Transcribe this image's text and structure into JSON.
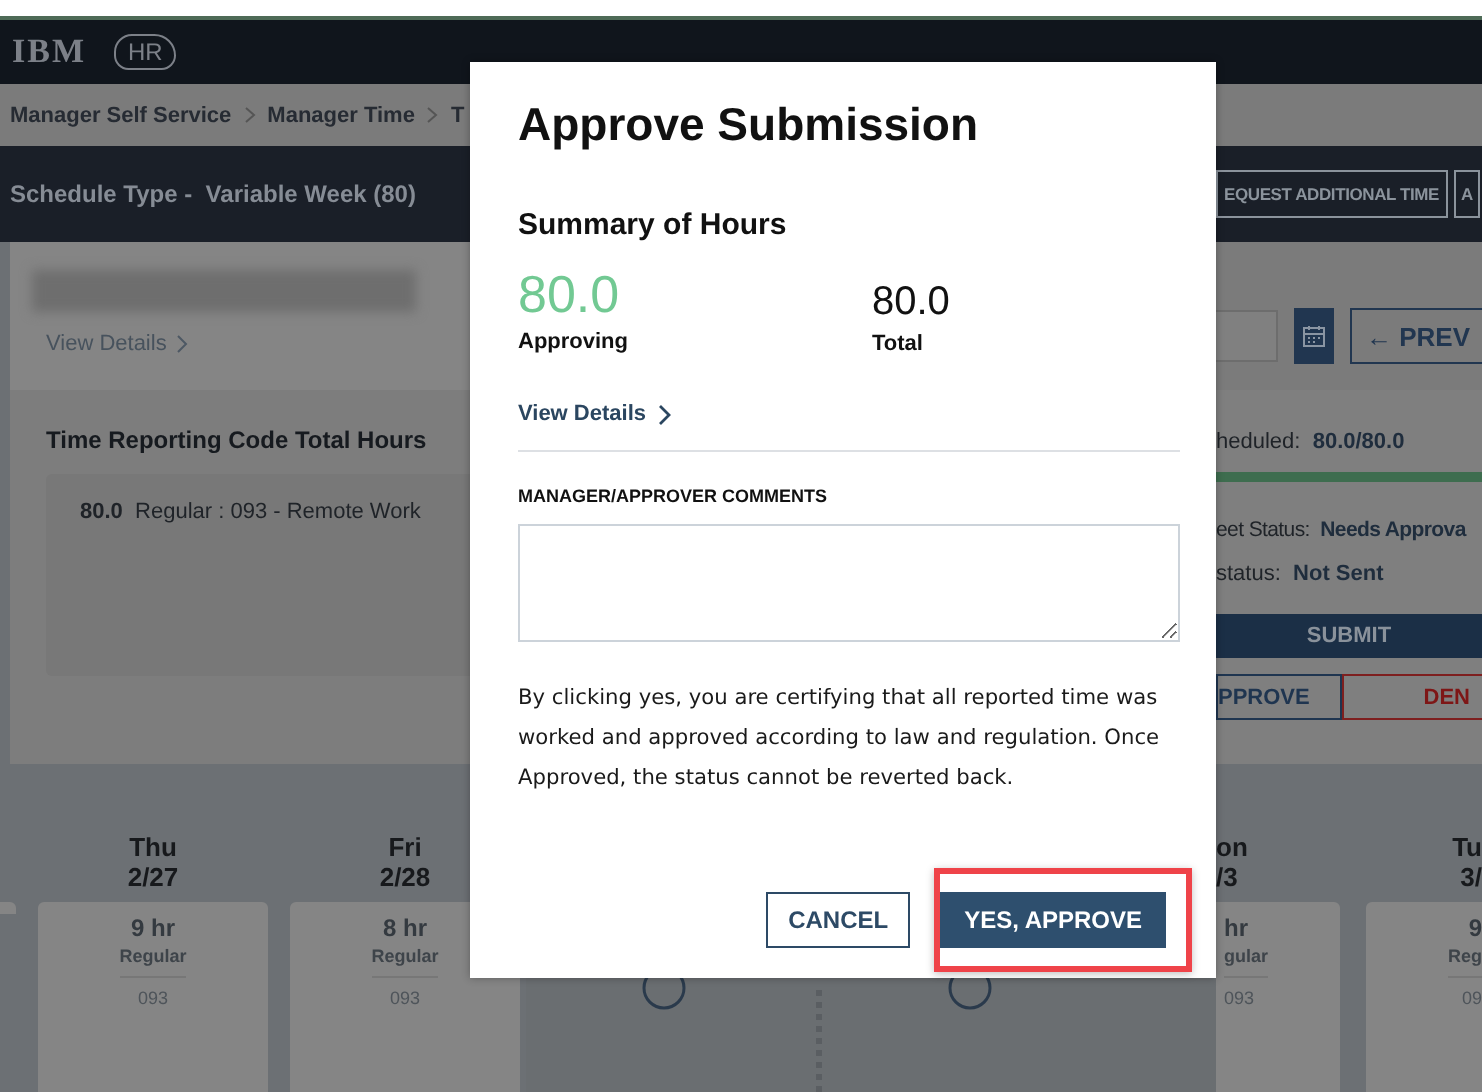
{
  "header": {
    "logo": "IBM",
    "app_badge": "HR"
  },
  "breadcrumb": [
    {
      "label": "Manager Self Service"
    },
    {
      "label": "Manager Time"
    },
    {
      "label": "T"
    }
  ],
  "schedule": {
    "label": "Schedule Type -",
    "value": "Variable Week (80)"
  },
  "toolbar_buttons": [
    {
      "label": "EQUEST ADDITIONAL TIME"
    },
    {
      "label": "A"
    }
  ],
  "employee": {
    "details_link": "View Details"
  },
  "trc": {
    "title": "Time Reporting Code Total Hours",
    "rows": [
      {
        "hours": "80.0",
        "label": "Regular : 093 - Remote Work"
      }
    ]
  },
  "period_nav": {
    "prev": "← PREV"
  },
  "status": {
    "scheduled_label": "heduled:",
    "scheduled_value": "80.0/80.0",
    "level": 1,
    "timesheet_label": "eet Status:",
    "timesheet_value": "Needs Approva",
    "approval_label": "status:",
    "approval_value": "Not Sent"
  },
  "actions": {
    "submit": "SUBMIT",
    "approve": "PPROVE",
    "deny": "DEN"
  },
  "days_left": [
    {
      "name": "Thu",
      "date": "2/27",
      "hours": "9 hr",
      "type": "Regular",
      "code": "093"
    },
    {
      "name": "Fri",
      "date": "2/28",
      "hours": "8 hr",
      "type": "Regular",
      "code": "093"
    }
  ],
  "days_right": [
    {
      "name": "on",
      "date": "/3",
      "hours": "hr",
      "type": "gular",
      "code": "093"
    },
    {
      "name": "Tu",
      "date": "3/",
      "hours": "9",
      "type": "Reg",
      "code": "09"
    }
  ],
  "dialog": {
    "title": "Approve Submission",
    "summary_title": "Summary of Hours",
    "approving_value": "80.0",
    "approving_label": "Approving",
    "total_value": "80.0",
    "total_label": "Total",
    "details_link": "View Details",
    "comments_label": "MANAGER/APPROVER COMMENTS",
    "notice": "By clicking yes, you are certifying that all reported time was worked and approved according to law and regulation. Once Approved, the status cannot be reverted back.",
    "buttons": [
      {
        "label": "CANCEL",
        "kind": "secondary",
        "highlighted": false
      },
      {
        "label": "YES, APPROVE",
        "kind": "primary",
        "highlighted": true
      }
    ]
  }
}
